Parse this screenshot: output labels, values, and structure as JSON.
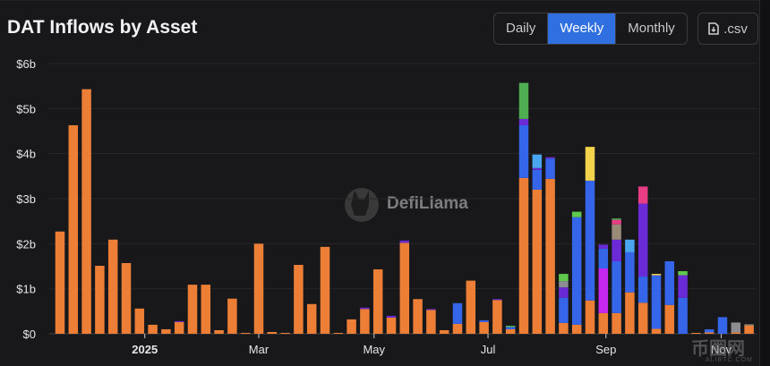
{
  "header": {
    "title": "DAT Inflows by Asset"
  },
  "controls": {
    "tabs": [
      {
        "label": "Daily",
        "active": false
      },
      {
        "label": "Weekly",
        "active": true
      },
      {
        "label": "Monthly",
        "active": false
      }
    ],
    "csv_label": ".csv"
  },
  "watermark": {
    "text": "DefiLlama"
  },
  "corner_watermark": {
    "text": "币圈网",
    "sub": "ALIBTC.COM"
  },
  "colors": {
    "orange": "#ec7f35",
    "blue": "#3565e8",
    "purple": "#6a2bd6",
    "green": "#4fae52",
    "lightblue": "#4aa6ee",
    "yellow": "#f4d34c",
    "magenta": "#c627ef",
    "pink": "#e83c85",
    "gray": "#8c8c92",
    "tan": "#9a8b78",
    "lime": "#5ec94c"
  },
  "chart_data": {
    "type": "bar",
    "stacked": true,
    "title": "DAT Inflows by Asset",
    "ylabel": "",
    "xlabel": "",
    "ylim": [
      0,
      6
    ],
    "yticks": [
      {
        "v": 0,
        "label": "$0"
      },
      {
        "v": 1,
        "label": "$1b"
      },
      {
        "v": 2,
        "label": "$2b"
      },
      {
        "v": 3,
        "label": "$3b"
      },
      {
        "v": 4,
        "label": "$4b"
      },
      {
        "v": 5,
        "label": "$5b"
      },
      {
        "v": 6,
        "label": "$6b"
      }
    ],
    "xticks": [
      {
        "i": 6.4,
        "label": "2025",
        "bold": true
      },
      {
        "i": 15,
        "label": "Mar"
      },
      {
        "i": 23.7,
        "label": "May"
      },
      {
        "i": 32.3,
        "label": "Jul"
      },
      {
        "i": 41.2,
        "label": "Sep"
      },
      {
        "i": 49.9,
        "label": "Nov"
      }
    ],
    "grid": true,
    "unit": "USD billions",
    "bars": [
      [
        [
          "orange",
          2.27
        ]
      ],
      [
        [
          "orange",
          4.63
        ]
      ],
      [
        [
          "orange",
          5.43
        ]
      ],
      [
        [
          "orange",
          1.51
        ]
      ],
      [
        [
          "orange",
          2.09
        ]
      ],
      [
        [
          "orange",
          1.57
        ]
      ],
      [
        [
          "orange",
          0.56
        ]
      ],
      [
        [
          "orange",
          0.2
        ]
      ],
      [
        [
          "orange",
          0.1
        ]
      ],
      [
        [
          "orange",
          0.26
        ],
        [
          "purple",
          0.02
        ]
      ],
      [
        [
          "orange",
          1.09
        ]
      ],
      [
        [
          "orange",
          1.09
        ]
      ],
      [
        [
          "orange",
          0.08
        ]
      ],
      [
        [
          "orange",
          0.78
        ]
      ],
      [
        [
          "orange",
          0.02
        ]
      ],
      [
        [
          "orange",
          2.0
        ]
      ],
      [
        [
          "orange",
          0.04
        ]
      ],
      [
        [
          "orange",
          0.02
        ]
      ],
      [
        [
          "orange",
          1.53
        ]
      ],
      [
        [
          "orange",
          0.66
        ]
      ],
      [
        [
          "orange",
          1.93
        ]
      ],
      [
        [
          "orange",
          0.02
        ]
      ],
      [
        [
          "orange",
          0.32
        ]
      ],
      [
        [
          "orange",
          0.55
        ],
        [
          "purple",
          0.03
        ]
      ],
      [
        [
          "orange",
          1.43
        ]
      ],
      [
        [
          "orange",
          0.36
        ],
        [
          "purple",
          0.04
        ]
      ],
      [
        [
          "orange",
          2.02
        ],
        [
          "purple",
          0.05
        ]
      ],
      [
        [
          "orange",
          0.77
        ]
      ],
      [
        [
          "orange",
          0.53
        ],
        [
          "purple",
          0.02
        ]
      ],
      [
        [
          "orange",
          0.08
        ]
      ],
      [
        [
          "orange",
          0.22
        ],
        [
          "blue",
          0.46
        ]
      ],
      [
        [
          "orange",
          1.18
        ]
      ],
      [
        [
          "orange",
          0.26
        ],
        [
          "blue",
          0.04
        ]
      ],
      [
        [
          "orange",
          0.75
        ],
        [
          "purple",
          0.02
        ]
      ],
      [
        [
          "orange",
          0.1
        ],
        [
          "blue",
          0.05
        ],
        [
          "green",
          0.03
        ]
      ],
      [
        [
          "orange",
          3.46
        ],
        [
          "blue",
          1.17
        ],
        [
          "purple",
          0.14
        ],
        [
          "green",
          0.8
        ]
      ],
      [
        [
          "orange",
          3.2
        ],
        [
          "blue",
          0.44
        ],
        [
          "purple",
          0.04
        ],
        [
          "lightblue",
          0.3
        ]
      ],
      [
        [
          "orange",
          3.44
        ],
        [
          "blue",
          0.45
        ],
        [
          "purple",
          0.03
        ]
      ],
      [
        [
          "orange",
          0.24
        ],
        [
          "blue",
          0.56
        ],
        [
          "purple",
          0.23
        ],
        [
          "gray",
          0.14
        ],
        [
          "lime",
          0.16
        ]
      ],
      [
        [
          "orange",
          0.2
        ],
        [
          "blue",
          2.39
        ],
        [
          "lime",
          0.12
        ]
      ],
      [
        [
          "orange",
          0.74
        ],
        [
          "blue",
          2.66
        ],
        [
          "yellow",
          0.75
        ]
      ],
      [
        [
          "orange",
          0.46
        ],
        [
          "magenta",
          0.99
        ],
        [
          "blue",
          0.44
        ],
        [
          "purple",
          0.09
        ]
      ],
      [
        [
          "orange",
          0.46
        ],
        [
          "blue",
          1.15
        ],
        [
          "purple",
          0.48
        ],
        [
          "tan",
          0.34
        ],
        [
          "pink",
          0.1
        ],
        [
          "green",
          0.03
        ]
      ],
      [
        [
          "orange",
          0.92
        ],
        [
          "blue",
          0.89
        ],
        [
          "lightblue",
          0.28
        ]
      ],
      [
        [
          "orange",
          0.69
        ],
        [
          "blue",
          0.58
        ],
        [
          "purple",
          1.62
        ],
        [
          "pink",
          0.38
        ]
      ],
      [
        [
          "orange",
          0.11
        ],
        [
          "blue",
          1.19
        ],
        [
          "yellow",
          0.03
        ]
      ],
      [
        [
          "orange",
          0.64
        ],
        [
          "blue",
          0.97
        ]
      ],
      [
        [
          "blue",
          0.8
        ],
        [
          "purple",
          0.5
        ],
        [
          "lime",
          0.09
        ]
      ],
      [
        [
          "orange",
          0.02
        ]
      ],
      [
        [
          "orange",
          0.03
        ],
        [
          "blue",
          0.07
        ]
      ],
      [
        [
          "blue",
          0.37
        ]
      ],
      [
        [
          "orange",
          0.03
        ],
        [
          "gray",
          0.22
        ]
      ],
      [
        [
          "orange",
          0.18
        ],
        [
          "tan",
          0.03
        ]
      ]
    ]
  }
}
